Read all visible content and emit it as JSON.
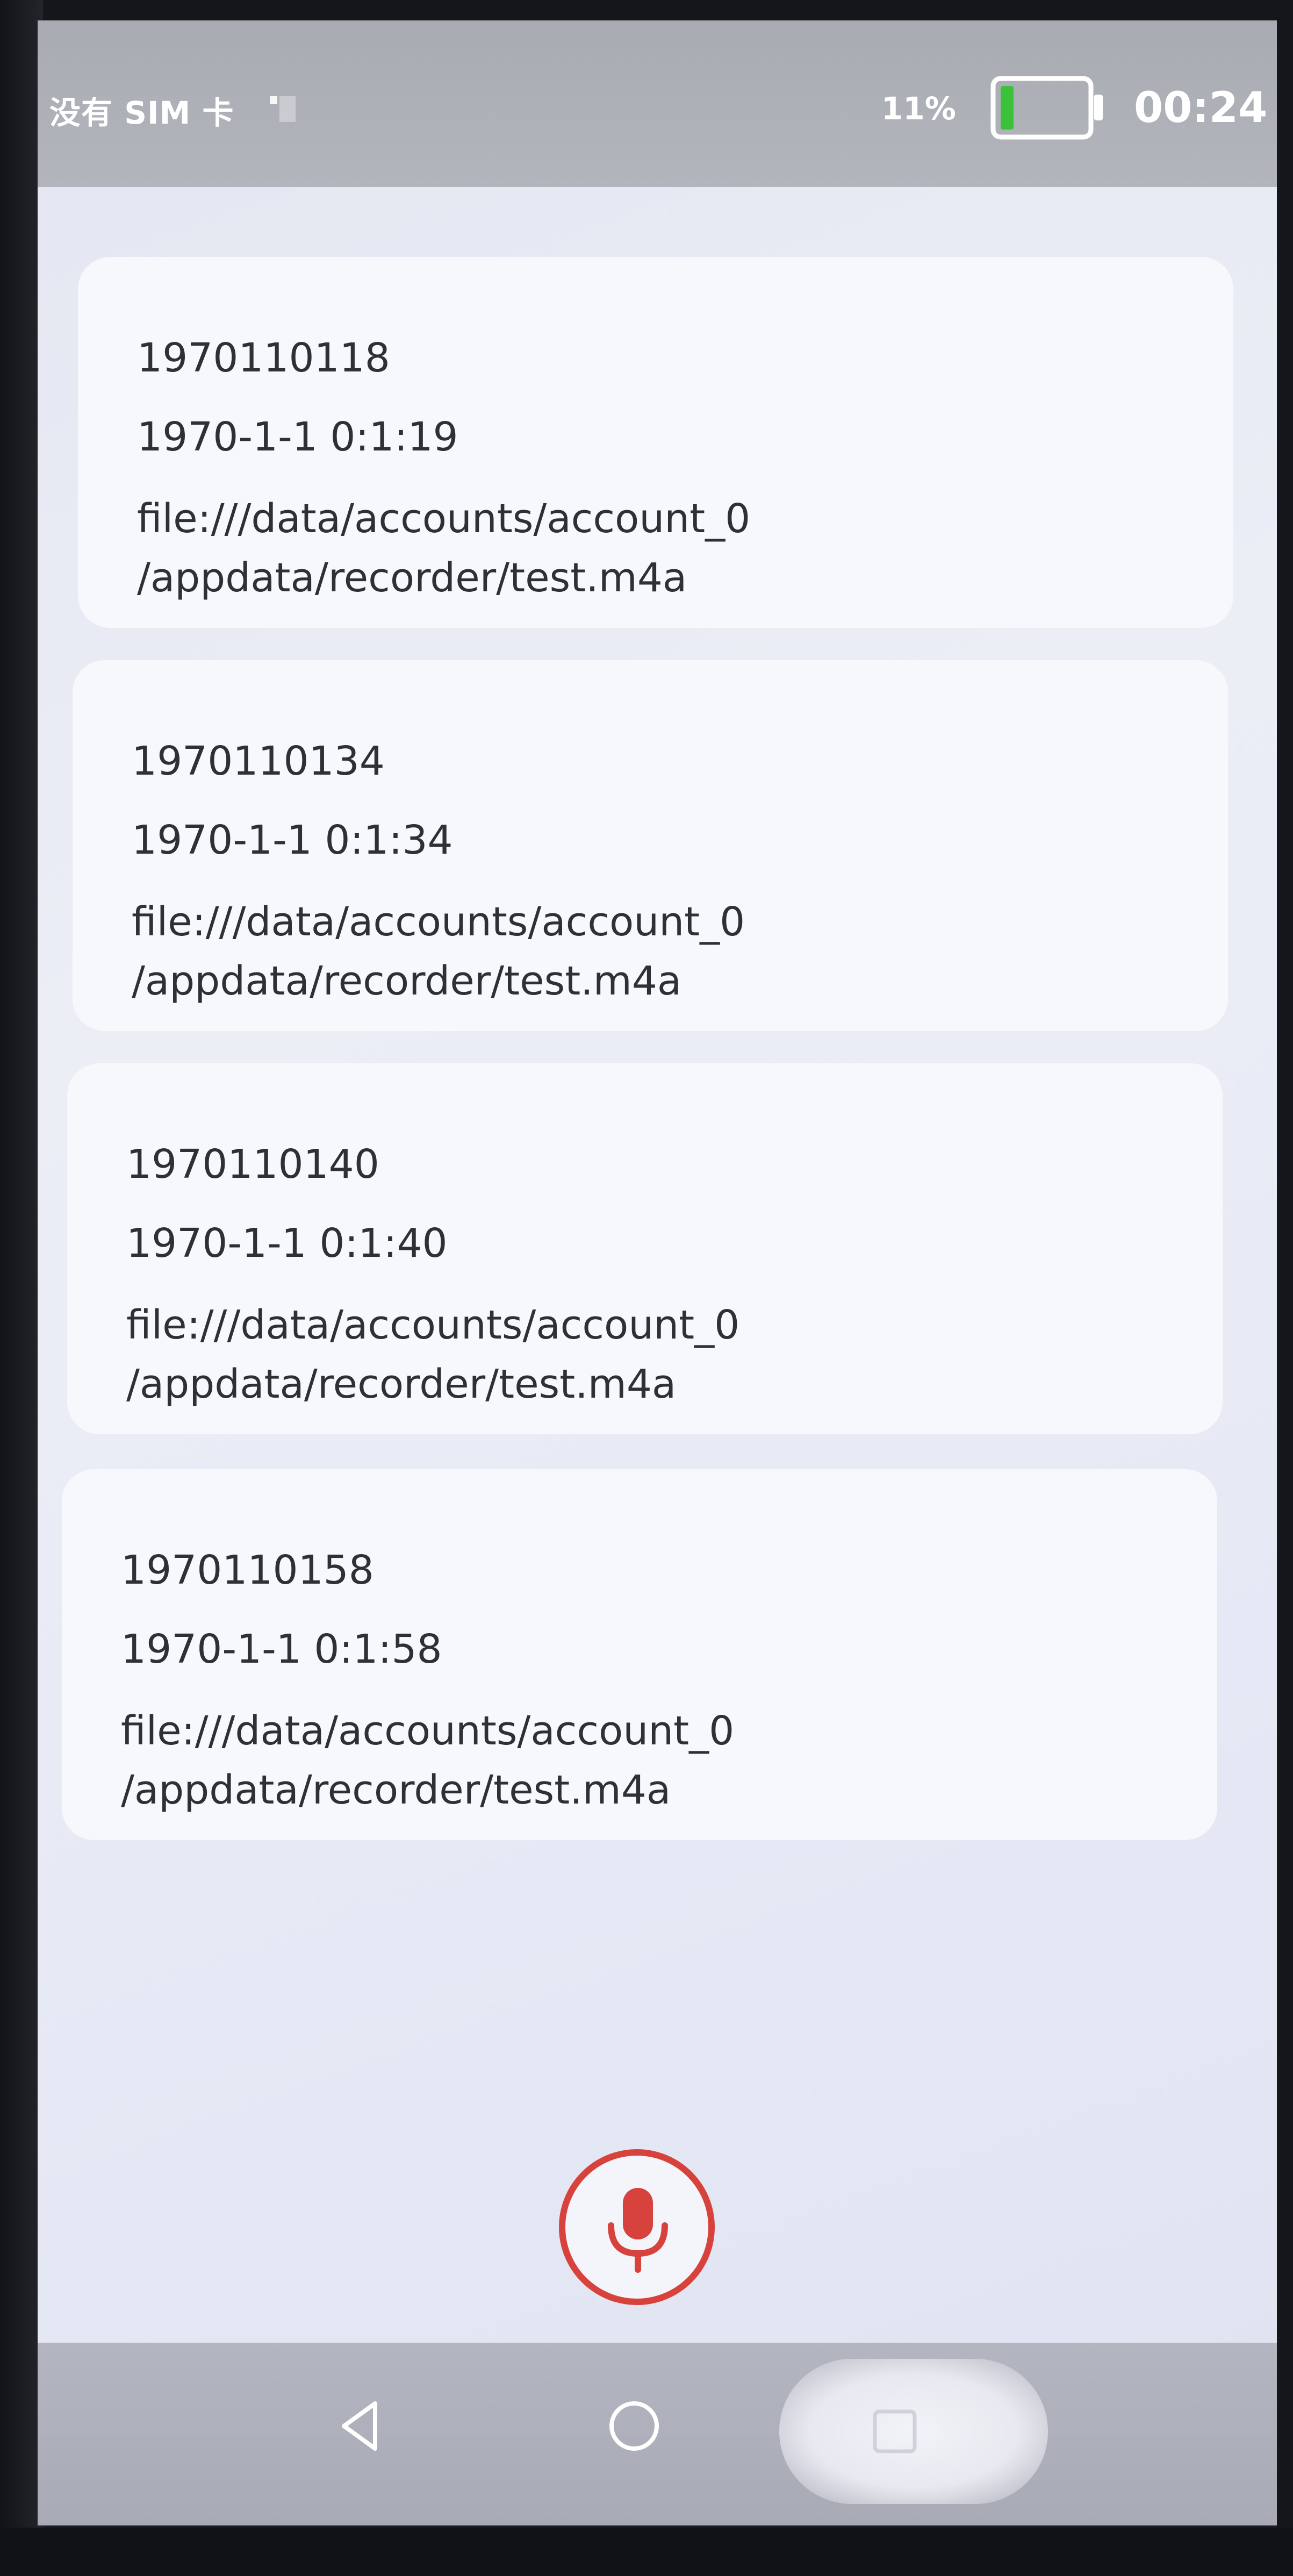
{
  "status_bar": {
    "carrier": "没有 SIM 卡",
    "battery_percent": "11%",
    "time": "00:24",
    "battery_color": "#3cc13b"
  },
  "recordings": [
    {
      "name": "1970110118",
      "time": "1970-1-1 0:1:19",
      "path": "file:///data/accounts/account_0\n/appdata/recorder/test.m4a"
    },
    {
      "name": "1970110134",
      "time": "1970-1-1 0:1:34",
      "path": "file:///data/accounts/account_0\n/appdata/recorder/test.m4a"
    },
    {
      "name": "1970110140",
      "time": "1970-1-1 0:1:40",
      "path": "file:///data/accounts/account_0\n/appdata/recorder/test.m4a"
    },
    {
      "name": "1970110158",
      "time": "1970-1-1 0:1:58",
      "path": "file:///data/accounts/account_0\n/appdata/recorder/test.m4a"
    }
  ],
  "record_button": {
    "icon": "microphone-icon",
    "accent_color": "#d8423d"
  },
  "nav_bar": {
    "back_icon": "triangle-back-icon",
    "home_icon": "circle-home-icon",
    "recent_icon": "square-recent-icon"
  }
}
